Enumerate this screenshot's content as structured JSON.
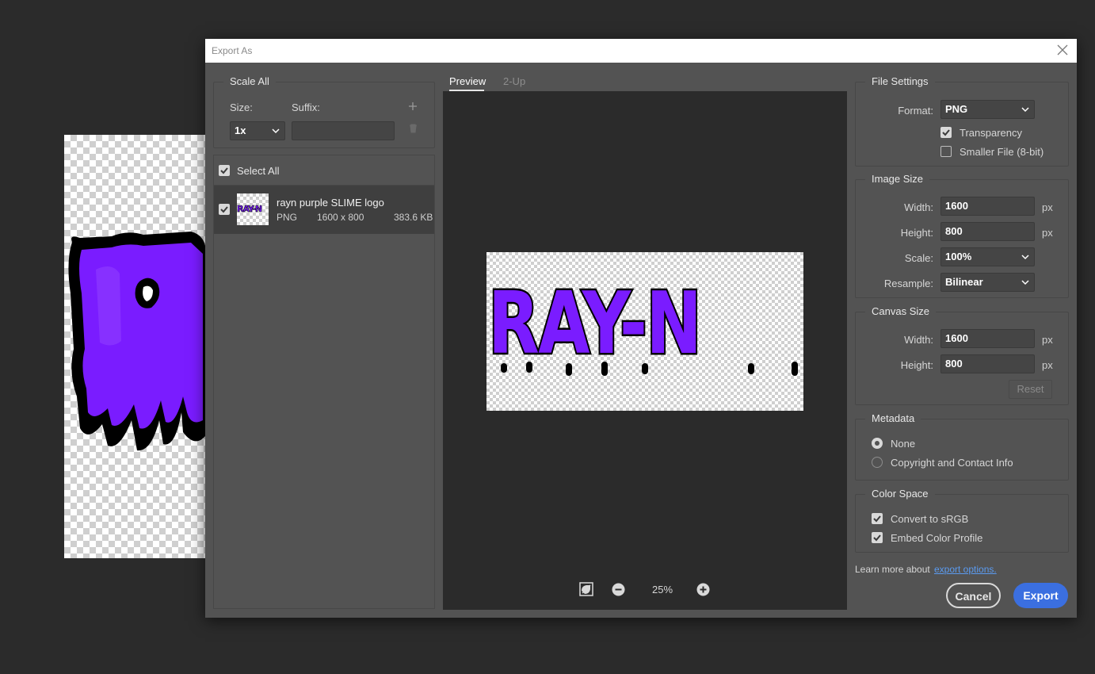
{
  "dialog": {
    "title": "Export As"
  },
  "scale_all": {
    "title": "Scale All",
    "size_label": "Size:",
    "suffix_label": "Suffix:",
    "size_value": "1x",
    "suffix_value": ""
  },
  "assets": {
    "select_all_label": "Select All",
    "items": [
      {
        "name": "rayn purple SLIME logo",
        "format": "PNG",
        "dimensions": "1600 x 800",
        "filesize": "383.6 KB",
        "thumb_text": "RAY-N"
      }
    ]
  },
  "preview": {
    "tabs": [
      "Preview",
      "2-Up"
    ],
    "active_tab": "Preview",
    "logo_text": "RAY-N",
    "zoom": "25%"
  },
  "file_settings": {
    "title": "File Settings",
    "format_label": "Format:",
    "format_value": "PNG",
    "transparency_label": "Transparency",
    "transparency_checked": true,
    "smaller_file_label": "Smaller File (8-bit)",
    "smaller_file_checked": false
  },
  "image_size": {
    "title": "Image Size",
    "width_label": "Width:",
    "width_value": "1600",
    "height_label": "Height:",
    "height_value": "800",
    "unit": "px",
    "scale_label": "Scale:",
    "scale_value": "100%",
    "resample_label": "Resample:",
    "resample_value": "Bilinear"
  },
  "canvas_size": {
    "title": "Canvas Size",
    "width_label": "Width:",
    "width_value": "1600",
    "height_label": "Height:",
    "height_value": "800",
    "unit": "px",
    "reset_label": "Reset"
  },
  "metadata": {
    "title": "Metadata",
    "options": [
      "None",
      "Copyright and Contact Info"
    ],
    "selected": "None"
  },
  "color_space": {
    "title": "Color Space",
    "convert_label": "Convert to sRGB",
    "convert_checked": true,
    "embed_label": "Embed Color Profile",
    "embed_checked": true
  },
  "footer": {
    "learn_more": "Learn more about",
    "link_text": "export options.",
    "cancel_label": "Cancel",
    "export_label": "Export"
  },
  "colors": {
    "accent": "#3b6fe0",
    "link": "#5b9bf0",
    "logo_purple": "#7a1cff",
    "dialog_bg": "#535353",
    "app_bg": "#2b2b2b"
  }
}
